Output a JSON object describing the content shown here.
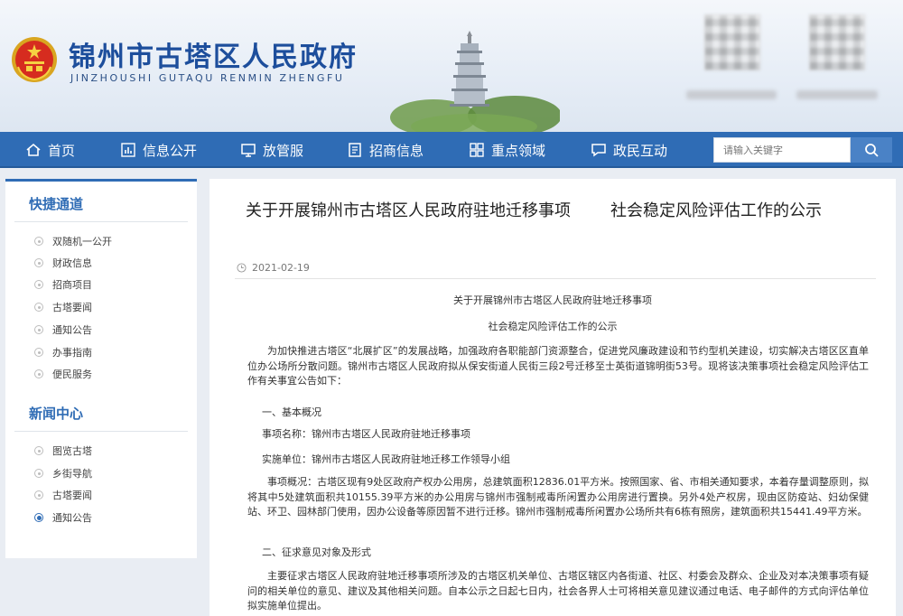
{
  "header": {
    "site_title": "锦州市古塔区人民政府",
    "site_subtitle": "JINZHOUSHI GUTAQU RENMIN ZHENGFU"
  },
  "nav": {
    "items": [
      {
        "label": "首页",
        "icon": "home-icon"
      },
      {
        "label": "信息公开",
        "icon": "bar-chart-icon"
      },
      {
        "label": "放管服",
        "icon": "monitor-icon"
      },
      {
        "label": "招商信息",
        "icon": "document-icon"
      },
      {
        "label": "重点领域",
        "icon": "grid-icon"
      },
      {
        "label": "政民互动",
        "icon": "chat-icon"
      }
    ],
    "search_placeholder": "请输入关键字"
  },
  "sidebar": {
    "quick_title": "快捷通道",
    "quick_items": [
      "双随机一公开",
      "财政信息",
      "招商项目",
      "古塔要闻",
      "通知公告",
      "办事指南",
      "便民服务"
    ],
    "news_title": "新闻中心",
    "news_items": [
      "图览古塔",
      "乡街导航",
      "古塔要闻",
      "通知公告"
    ],
    "news_active_index": 3
  },
  "article": {
    "title_part1": "关于开展锦州市古塔区人民政府驻地迁移事项",
    "title_part2": "社会稳定风险评估工作的公示",
    "date": "2021-02-19",
    "doc_title_line1": "关于开展锦州市古塔区人民政府驻地迁移事项",
    "doc_title_line2": "社会稳定风险评估工作的公示",
    "intro": "为加快推进古塔区“北展扩区”的发展战略，加强政府各职能部门资源整合，促进党风廉政建设和节约型机关建设，切实解决古塔区区直单位办公场所分散问题。锦州市古塔区人民政府拟从保安街道人民街三段2号迁移至士英街道锦明街53号。现将该决策事项社会稳定风险评估工作有关事宜公告如下：",
    "section1": "一、基本概况",
    "item_name": "事项名称：锦州市古塔区人民政府驻地迁移事项",
    "item_unit": "实施单位：锦州市古塔区人民政府驻地迁移工作领导小组",
    "overview": "事项概况：古塔区现有9处区政府产权办公用房，总建筑面积12836.01平方米。按照国家、省、市相关通知要求，本着存量调整原则，拟将其中5处建筑面积共10155.39平方米的办公用房与锦州市强制戒毒所闲置办公用房进行置换。另外4处产权房，现由区防疫站、妇幼保健站、环卫、园林部门使用，因办公设备等原因暂不进行迁移。锦州市强制戒毒所闲置办公场所共有6栋有照房，建筑面积共15441.49平方米。",
    "section2": "二、征求意见对象及形式",
    "consult": "主要征求古塔区人民政府驻地迁移事项所涉及的古塔区机关单位、古塔区辖区内各街道、社区、村委会及群众、企业及对本决策事项有疑问的相关单位的意见、建议及其他相关问题。自本公示之日起七日内，社会各界人士可将相关意见建议通过电话、电子邮件的方式向评估单位拟实施单位提出。"
  },
  "colors": {
    "brand_blue": "#2f6cb5",
    "title_blue": "#1d4e9c",
    "page_bg": "#e9edf3"
  }
}
